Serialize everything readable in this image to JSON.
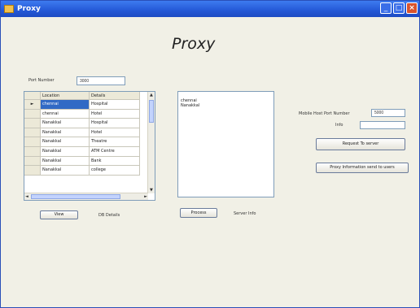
{
  "window": {
    "title": "Proxy"
  },
  "title_buttons": {
    "min": "_",
    "max": "□",
    "close": "×"
  },
  "heading": "Proxy",
  "port": {
    "label": "Port Number",
    "value": "3000"
  },
  "grid": {
    "columns": [
      "Location",
      "Details"
    ],
    "row_indicator": "►",
    "rows": [
      [
        "chennai",
        "Hospital"
      ],
      [
        "chennai",
        "Hotel"
      ],
      [
        "Nanakkal",
        "Hospital"
      ],
      [
        "Nanakkal",
        "Hotel"
      ],
      [
        "Nanakkal",
        "Theatre"
      ],
      [
        "Nanakkal",
        "ATM Centre"
      ],
      [
        "Nanakkal",
        "Bank"
      ],
      [
        "Nanakkal",
        "college"
      ]
    ],
    "selected_row": 0,
    "scroll_up": "▲",
    "scroll_down": "▼",
    "scroll_left": "◄",
    "scroll_right": "►"
  },
  "view_button": "View",
  "db_details_label": "DB Details",
  "server_list": [
    "chennai",
    "Nanakkal"
  ],
  "process_button": "Process",
  "server_info_label": "Server Info",
  "mobile": {
    "label": "Mobile Host Port Number",
    "value": "5000"
  },
  "info": {
    "label": "Info",
    "value": ""
  },
  "request_button": "Request To server",
  "proxy_info_button": "Proxy Information send to users"
}
